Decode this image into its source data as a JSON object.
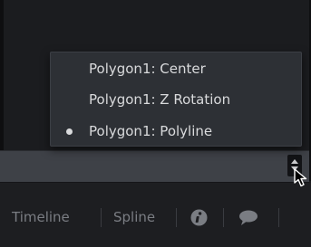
{
  "popup_menu": {
    "items": [
      {
        "label": "Polygon1: Center",
        "selected": false
      },
      {
        "label": "Polygon1: Z Rotation",
        "selected": false
      },
      {
        "label": "Polygon1: Polyline",
        "selected": true
      }
    ]
  },
  "toolbar": {
    "tabs": [
      {
        "label": "Timeline"
      },
      {
        "label": "Spline"
      }
    ],
    "icons": [
      "info-icon",
      "comment-icon"
    ]
  },
  "colors": {
    "background": "#1a1b1e",
    "control_bar": "#3e4147",
    "menu_background": "#2d3035",
    "menu_text": "#d9dadc",
    "toolbar_text": "#7a7d83"
  }
}
